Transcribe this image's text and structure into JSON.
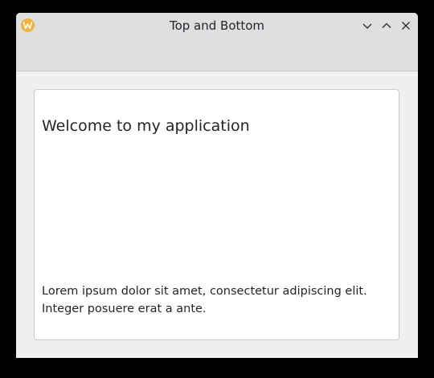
{
  "window": {
    "title": "Top and Bottom",
    "app_icon": "w-logo-icon",
    "controls": [
      "minimize",
      "maximize",
      "close"
    ]
  },
  "content": {
    "heading": "Welcome to my application",
    "body_line1": "Lorem ipsum dolor sit amet, consectetur adipiscing elit.",
    "body_line2": "Integer posuere erat a ante."
  },
  "colors": {
    "titlebar": "#dedfe1",
    "window_bg": "#eeeff1",
    "card_bg": "#ffffff",
    "text": "#232629",
    "app_icon": "#f0b23c"
  }
}
